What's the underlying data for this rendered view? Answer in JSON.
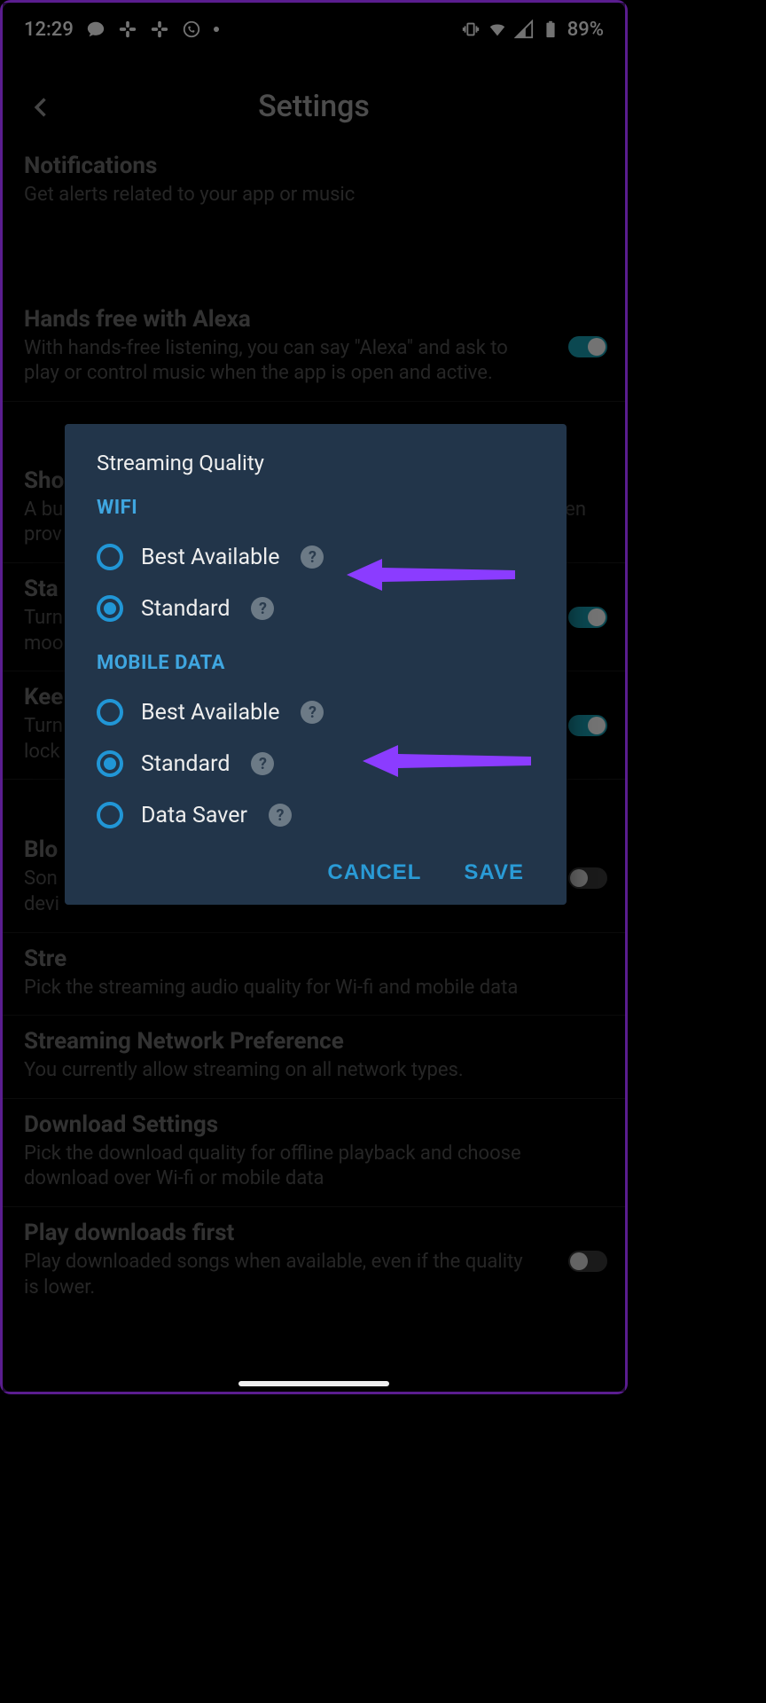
{
  "status": {
    "time": "12:29",
    "battery": "89%"
  },
  "header": {
    "title": "Settings"
  },
  "settings": {
    "notifications": {
      "title": "Notifications",
      "sub": "Get alerts related to your app or music"
    },
    "alexa": {
      "title": "Hands free with Alexa",
      "sub": "With hands-free listening, you can say \"Alexa\" and ask to play or control music when the app is open and active.",
      "toggle": true
    },
    "showfriends": {
      "title": "Sho",
      "sub": "A bu\nprov",
      "toggle_cut": true
    },
    "standby": {
      "title": "Sta",
      "sub": "Turn\nmoo",
      "toggle": true
    },
    "keep": {
      "title": "Kee",
      "sub": "Turn\nlock",
      "toggle": true
    },
    "block": {
      "title": "Blo",
      "sub": "Son\ndevi",
      "toggle": false
    },
    "streamingq": {
      "title": "Stre",
      "sub": "Pick the streaming audio quality for Wi-fi and mobile data"
    },
    "network": {
      "title": "Streaming Network Preference",
      "sub": "You currently allow streaming on all network types."
    },
    "download": {
      "title": "Download Settings",
      "sub": "Pick the download quality for offline playback and choose download over Wi-fi or mobile data"
    },
    "playfirst": {
      "title": "Play downloads first",
      "sub": "Play downloaded songs when available, even if the quality is lower.",
      "toggle": false
    }
  },
  "dialog": {
    "title": "Streaming Quality",
    "wifi": {
      "label": "WIFI",
      "options": [
        {
          "label": "Best Available",
          "checked": false
        },
        {
          "label": "Standard",
          "checked": true
        }
      ]
    },
    "mobile": {
      "label": "MOBILE DATA",
      "options": [
        {
          "label": "Best Available",
          "checked": false
        },
        {
          "label": "Standard",
          "checked": true
        },
        {
          "label": "Data Saver",
          "checked": false
        }
      ]
    },
    "cancel": "CANCEL",
    "save": "SAVE"
  }
}
